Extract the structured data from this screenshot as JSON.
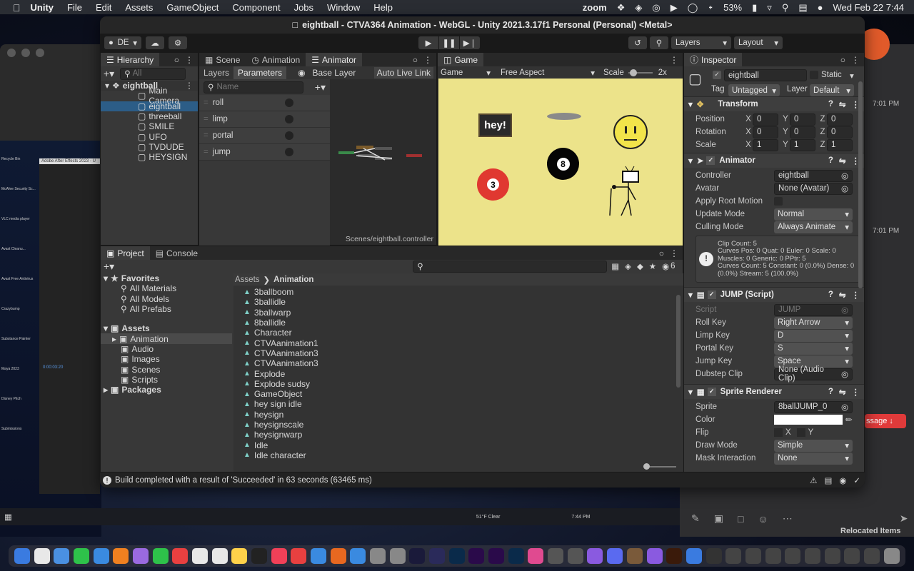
{
  "menubar": {
    "app": "Unity",
    "items": [
      "File",
      "Edit",
      "Assets",
      "GameObject",
      "Component",
      "Jobs",
      "Window",
      "Help"
    ],
    "status": {
      "zoom": "zoom",
      "battery": "53%",
      "datetime": "Wed Feb 22  7:44"
    }
  },
  "window": {
    "title": "eightball - CTVA364 Animation - WebGL - Unity 2021.3.17f1 Personal (Personal) <Metal>"
  },
  "toolbar": {
    "account": "DE",
    "search_layers": "Layers",
    "layout": "Layout"
  },
  "hierarchy": {
    "tab": "Hierarchy",
    "search_placeholder": "All",
    "root": "eightball",
    "items": [
      "Main Camera",
      "eightball",
      "threeball",
      "SMILE",
      "UFO",
      "TVDUDE",
      "HEYSIGN"
    ]
  },
  "animator": {
    "tabs": [
      "Scene",
      "Animation",
      "Animator"
    ],
    "subtabs": [
      "Layers",
      "Parameters"
    ],
    "base_layer": "Base Layer",
    "auto_live_link": "Auto Live Link",
    "name_placeholder": "Name",
    "params": [
      "roll",
      "limp",
      "portal",
      "jump"
    ],
    "path": "Scenes/eightball.controller"
  },
  "game": {
    "tab": "Game",
    "display": "Game",
    "aspect": "Free Aspect",
    "scale_label": "Scale",
    "scale_value": "2x",
    "sign_text": "hey!",
    "ball8": "8",
    "ball3": "3"
  },
  "inspector": {
    "tab": "Inspector",
    "object_name": "eightball",
    "static_label": "Static",
    "tag_label": "Tag",
    "tag": "Untagged",
    "layer_label": "Layer",
    "layer": "Default",
    "transform": {
      "title": "Transform",
      "position": "Position",
      "rotation": "Rotation",
      "scale": "Scale",
      "pos": [
        "0",
        "0",
        "0"
      ],
      "rot": [
        "0",
        "0",
        "0"
      ],
      "scl": [
        "1",
        "1",
        "1"
      ],
      "axes": [
        "X",
        "Y",
        "Z"
      ]
    },
    "animator": {
      "title": "Animator",
      "controller_label": "Controller",
      "controller": "eightball",
      "avatar_label": "Avatar",
      "avatar": "None (Avatar)",
      "apply_root_motion": "Apply Root Motion",
      "update_mode_label": "Update Mode",
      "update_mode": "Normal",
      "culling_mode_label": "Culling Mode",
      "culling_mode": "Always Animate",
      "info": "Clip Count: 5\nCurves Pos: 0 Quat: 0 Euler: 0 Scale: 0\nMuscles: 0 Generic: 0 PPtr: 5\nCurves Count: 5 Constant: 0 (0.0%) Dense: 0 (0.0%) Stream: 5 (100.0%)"
    },
    "jump": {
      "title": "JUMP (Script)",
      "script_label": "Script",
      "script": "JUMP",
      "roll_key_label": "Roll Key",
      "roll_key": "Right Arrow",
      "limp_key_label": "Limp Key",
      "limp_key": "D",
      "portal_key_label": "Portal Key",
      "portal_key": "S",
      "jump_key_label": "Jump Key",
      "jump_key": "Space",
      "dubstep_label": "Dubstep Clip",
      "dubstep": "None (Audio Clip)"
    },
    "sprite": {
      "title": "Sprite Renderer",
      "sprite_label": "Sprite",
      "sprite": "8ballJUMP_0",
      "color_label": "Color",
      "flip_label": "Flip",
      "flip_x": "X",
      "flip_y": "Y",
      "draw_mode_label": "Draw Mode",
      "draw_mode": "Simple",
      "mask_label": "Mask Interaction",
      "mask": "None"
    }
  },
  "project": {
    "tabs": [
      "Project",
      "Console"
    ],
    "favorites": "Favorites",
    "fav_items": [
      "All Materials",
      "All Models",
      "All Prefabs"
    ],
    "assets": "Assets",
    "asset_folders": [
      "Animation",
      "Audio",
      "Images",
      "Scenes",
      "Scripts"
    ],
    "packages": "Packages",
    "breadcrumb": [
      "Assets",
      "Animation"
    ],
    "hidden_count": "6",
    "files": [
      "3ballboom",
      "3ballidle",
      "3ballwarp",
      "8ballidle",
      "Character",
      "CTVAanimation1",
      "CTVAanimation3",
      "CTVAanimation3",
      "Explode",
      "Explode sudsy",
      "GameObject",
      "hey sign idle",
      "heysign",
      "heysignscale",
      "heysignwarp",
      "Idle",
      "Idle character"
    ]
  },
  "status": {
    "message": "Build completed with a result of 'Succeeded' in 63 seconds (63465 ms)"
  },
  "background": {
    "times": [
      "7:01 PM",
      "7:01 PM"
    ],
    "message_btn": "ssage ↓",
    "relocated": "Relocated Items",
    "ae_title": "Adobe After Effects 2023 - U",
    "ae_time": "0:00:03:20",
    "weather": "51°F  Clear",
    "taskbar_time": "7:44 PM",
    "desktop_icons": [
      "Recycle Bin",
      "McAfee Security Sc...",
      "VLC media player",
      "Avast Cleanu...",
      "Avast Free Antivirus",
      "Crazybump",
      "Substance Painter",
      "Maya 2023",
      "Disney Pitch Submissions"
    ]
  },
  "colors": {
    "game_bg": "#ece38a",
    "selection": "#2c5d87",
    "panel": "#383838",
    "accent": "#4a90d9"
  }
}
